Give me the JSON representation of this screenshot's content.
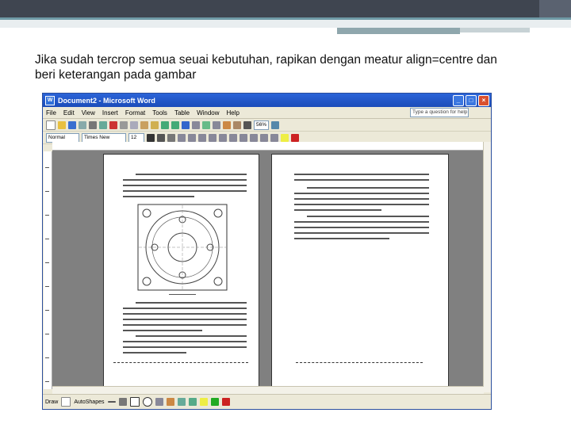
{
  "slide": {
    "text": "Jika sudah tercrop semua seuai kebutuhan, rapikan dengan meatur align=centre dan beri keterangan pada gambar"
  },
  "window": {
    "title": "Document2 - Microsoft Word",
    "menu": [
      "File",
      "Edit",
      "View",
      "Insert",
      "Format",
      "Tools",
      "Table",
      "Window",
      "Help"
    ],
    "help_box": "Type a question for help",
    "style_value": "Normal",
    "font_value": "Times New Roman",
    "size_value": "12",
    "zoom_value": "56%",
    "draw_label": "Draw",
    "autoshapes_label": "AutoShapes"
  },
  "colors": {
    "title_bar": "#1b4cb9",
    "slide_band": "#3f4550",
    "accent": "#6f9aa6"
  }
}
